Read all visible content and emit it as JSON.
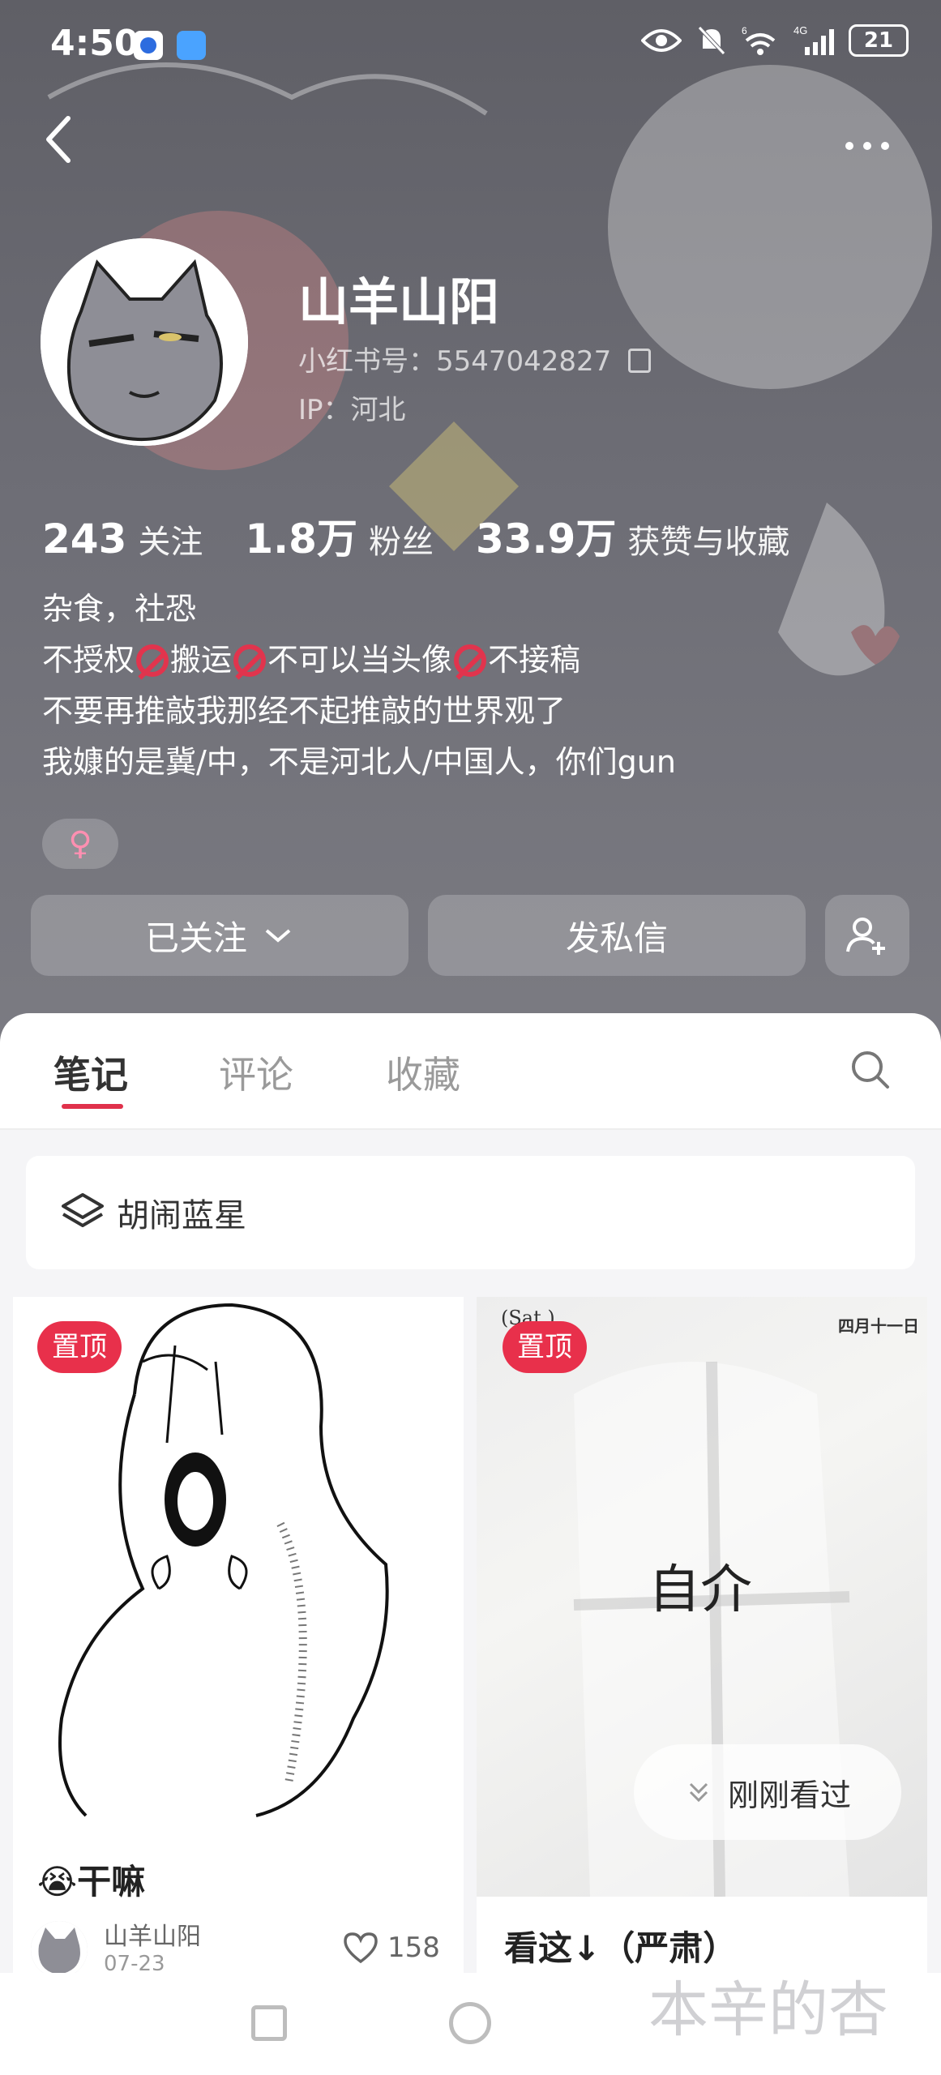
{
  "status_bar": {
    "time": "4:50",
    "battery": "21",
    "network_label": "4G",
    "signal_label": "6"
  },
  "profile": {
    "name": "山羊山阳",
    "red_id_label": "小红书号：5547042827",
    "ip_label": "IP：河北",
    "stats": [
      {
        "value": "243",
        "label": "关注"
      },
      {
        "value": "1.8万",
        "label": "粉丝"
      },
      {
        "value": "33.9万",
        "label": "获赞与收藏"
      }
    ],
    "bio_lines": {
      "line1": "杂食，社恐",
      "line2_parts": [
        "不授权",
        "搬运",
        "不可以当头像",
        "不接稿"
      ],
      "line3": "不要再推敲我那经不起推敲的世界观了",
      "line4": "我嫝的是冀/中，不是河北人/中国人，你们gun"
    },
    "gender_symbol": "♀"
  },
  "actions": {
    "follow_label": "已关注",
    "message_label": "发私信"
  },
  "tabs": [
    {
      "label": "笔记",
      "active": true
    },
    {
      "label": "评论",
      "active": false
    },
    {
      "label": "收藏",
      "active": false
    }
  ],
  "collection": {
    "label": "胡闹蓝星"
  },
  "cards": [
    {
      "pin_label": "置顶",
      "title": "😭干嘛",
      "author": "山羊山阳",
      "date": "07-23",
      "likes": "158"
    },
    {
      "pin_label": "置顶",
      "cover_top_left": "(Sat.)",
      "cover_top_right": "四月十一日",
      "cover_text": "自介",
      "recent_label": "刚刚看过",
      "title": "看这↓（严肃）"
    }
  ],
  "watermark": "本辛的杏",
  "colors": {
    "accent": "#e0314b",
    "pin": "#e8304b",
    "header_bg": "#6a6a72"
  }
}
